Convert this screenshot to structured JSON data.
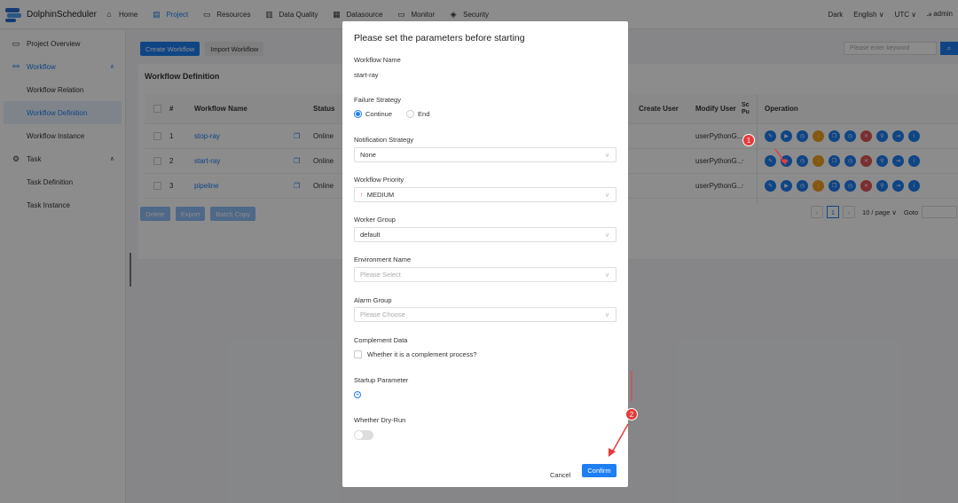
{
  "nav": {
    "logo": "DolphinScheduler",
    "items": [
      {
        "label": "Home",
        "icon": "home-icon"
      },
      {
        "label": "Project",
        "icon": "project-icon"
      },
      {
        "label": "Resources",
        "icon": "folder-icon"
      },
      {
        "label": "Data Quality",
        "icon": "document-icon"
      },
      {
        "label": "Datasource",
        "icon": "database-icon"
      },
      {
        "label": "Monitor",
        "icon": "monitor-icon"
      },
      {
        "label": "Security",
        "icon": "shield-icon"
      }
    ],
    "theme": "Dark",
    "language": "English",
    "timezone": "UTC",
    "user": "admin"
  },
  "sidebar": {
    "items": [
      {
        "label": "Project Overview"
      },
      {
        "label": "Workflow"
      },
      {
        "label": "Workflow Relation"
      },
      {
        "label": "Workflow Definition"
      },
      {
        "label": "Workflow Instance"
      },
      {
        "label": "Task"
      },
      {
        "label": "Task Definition"
      },
      {
        "label": "Task Instance"
      }
    ]
  },
  "main": {
    "create_btn": "Create Workflow",
    "import_btn": "Import Workflow",
    "search_placeholder": "Please enter keyword",
    "card_title": "Workflow Definition",
    "columns": {
      "num": "#",
      "name": "Workflow Name",
      "status": "Status",
      "create_user": "Create User",
      "modify_user": "Modify User",
      "sched_line1": "Sc",
      "sched_line2": "Pu",
      "operation": "Operation"
    },
    "rows": [
      {
        "num": "1",
        "name": "stop-ray",
        "status": "Online",
        "modify_user": "userPythonG...",
        "sched": ""
      },
      {
        "num": "2",
        "name": "start-ray",
        "status": "Online",
        "modify_user": "userPythonG...",
        "sched": "-"
      },
      {
        "num": "3",
        "name": "pipeline",
        "status": "Online",
        "modify_user": "userPythonG...",
        "sched": "-"
      }
    ],
    "bottom": {
      "delete": "Delete",
      "export": "Export",
      "batch_copy": "Batch Copy"
    },
    "pager": {
      "current": "1",
      "page_size": "10 / page",
      "goto": "Goto"
    }
  },
  "modal": {
    "title": "Please set the parameters before starting",
    "workflow_name_label": "Workflow Name",
    "workflow_name_value": "start-ray",
    "failure_strategy_label": "Failure Strategy",
    "failure_continue": "Continue",
    "failure_end": "End",
    "notification_label": "Notification Strategy",
    "notification_value": "None",
    "priority_label": "Workflow Priority",
    "priority_value": "MEDIUM",
    "worker_group_label": "Worker Group",
    "worker_group_value": "default",
    "env_label": "Environment Name",
    "env_placeholder": "Please Select",
    "alarm_label": "Alarm Group",
    "alarm_placeholder": "Please Choose",
    "complement_label": "Complement Data",
    "complement_checkbox": "Whether it is a complement process?",
    "startup_label": "Startup Parameter",
    "dryrun_label": "Whether Dry-Run",
    "cancel": "Cancel",
    "confirm": "Confirm"
  },
  "annotations": {
    "marker1": "1",
    "marker2": "2"
  }
}
